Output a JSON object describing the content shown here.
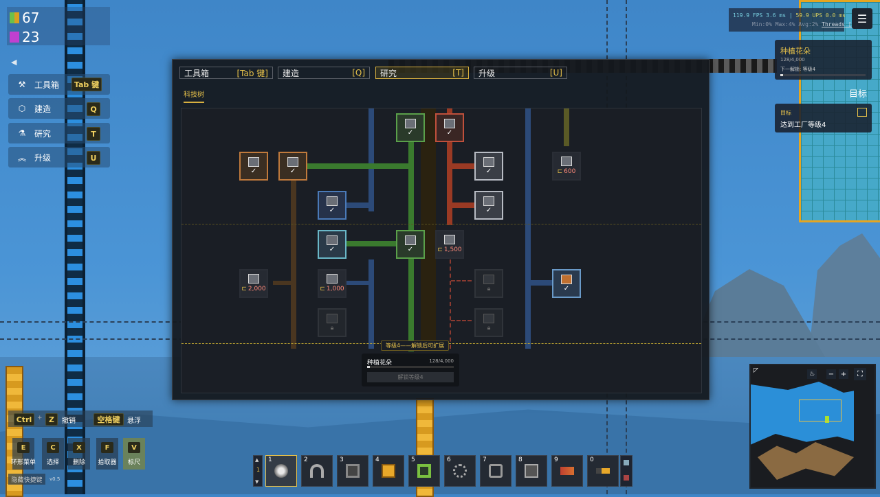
{
  "resources": {
    "green": "67",
    "purple": "23"
  },
  "side_menu": {
    "back_arrow": "◀",
    "items": [
      {
        "label": "工具箱",
        "key": "Tab 键"
      },
      {
        "label": "建造",
        "key": "Q"
      },
      {
        "label": "研究",
        "key": "T"
      },
      {
        "label": "升级",
        "key": "U"
      }
    ]
  },
  "tabs": [
    {
      "label": "工具箱",
      "key": "[Tab 键]"
    },
    {
      "label": "建造",
      "key": "[Q]"
    },
    {
      "label": "研究",
      "key": "[T]"
    },
    {
      "label": "升级",
      "key": "[U]"
    }
  ],
  "subtab": "科技树",
  "nodes": [
    {
      "check": "✓",
      "cost": ""
    },
    {
      "check": "✓",
      "cost": ""
    },
    {
      "check": "✓",
      "cost": ""
    },
    {
      "check": "✓",
      "cost": ""
    },
    {
      "check": "✓",
      "cost": ""
    },
    {
      "check": "",
      "cost": "600"
    },
    {
      "check": "✓",
      "cost": ""
    },
    {
      "check": "✓",
      "cost": ""
    },
    {
      "check": "✓",
      "cost": ""
    },
    {
      "check": "✓",
      "cost": ""
    },
    {
      "check": "",
      "cost": "1,500"
    },
    {
      "check": "",
      "cost": "2,000"
    },
    {
      "check": "",
      "cost": "1,000"
    },
    {
      "check": "✓",
      "cost": ""
    }
  ],
  "level_hint": "等级4——解锁后可扩展",
  "goal": {
    "title": "种植花朵",
    "progress": "128/4,000",
    "progress_fraction": 0.032,
    "button": "解锁等级4"
  },
  "perf": {
    "line1a": "119.9 FPS  3.6 ms |",
    "line1b": "59.9 UPS  0.0 ms",
    "line2": "Min:0% Max:4% Avg:2%",
    "threads": "Threads [+]"
  },
  "quest_main": {
    "title": "种植花朵",
    "progress": "128/4,000",
    "next": "下一解锁: 等级4",
    "progress_fraction": 0.032
  },
  "objective_header": "目标",
  "quest_goal": {
    "label": "目标",
    "text": "达到工厂等级4"
  },
  "undo": {
    "ctrl": "Ctrl",
    "plus": "+",
    "z": "Z",
    "undo_label": "撤销",
    "space": "空格键",
    "hover_label": "悬浮"
  },
  "hotkeys": [
    {
      "key": "E",
      "label": "环形菜单"
    },
    {
      "key": "C",
      "label": "选择"
    },
    {
      "key": "X",
      "label": "删除"
    },
    {
      "key": "F",
      "label": "拾取器"
    },
    {
      "key": "V",
      "label": "标尺"
    }
  ],
  "hide_shortcuts": "隐藏快捷键",
  "version": "v0.5",
  "hotbar": {
    "page": "1",
    "slots": [
      "1",
      "2",
      "3",
      "4",
      "5",
      "6",
      "7",
      "8",
      "9",
      "0"
    ]
  },
  "minimap_controls": {
    "minus": "−",
    "plus": "+"
  },
  "colors": {
    "accent": "#e8c24a",
    "green_line": "#4a9a3a",
    "blue_line": "#3c6aa8",
    "orange_line": "#c0502c",
    "brown_line": "#5a4028",
    "olive_line": "#6a6a2a"
  }
}
